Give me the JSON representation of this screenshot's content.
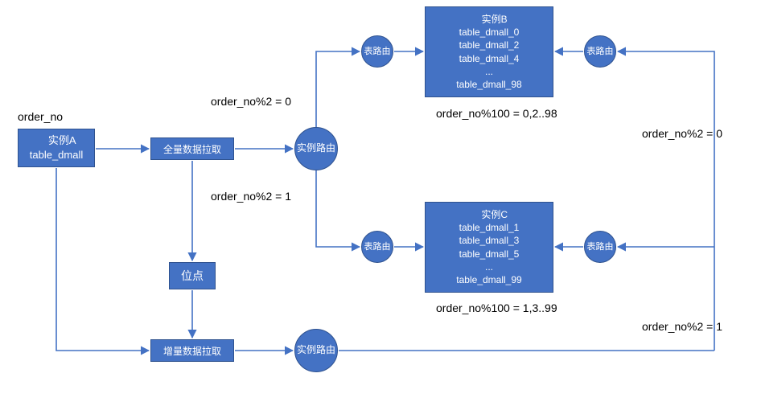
{
  "labels": {
    "shard_key": "order_no",
    "cond_even": "order_no%2 = 0",
    "cond_odd": "order_no%2 = 1",
    "mod_even": "order_no%100 = 0,2..98",
    "mod_odd": "order_no%100 = 1,3..99"
  },
  "nodes": {
    "instanceA": {
      "title": "实例A",
      "table": "table_dmall"
    },
    "full_fetch": "全量数据拉取",
    "checkpoint": "位点",
    "inc_fetch": "增量数据拉取",
    "instance_router": "实例路由",
    "table_router": "表路由",
    "instanceB": {
      "title": "实例B",
      "tables": [
        "table_dmall_0",
        "table_dmall_2",
        "table_dmall_4",
        "...",
        "table_dmall_98"
      ]
    },
    "instanceC": {
      "title": "实例C",
      "tables": [
        "table_dmall_1",
        "table_dmall_3",
        "table_dmall_5",
        "...",
        "table_dmall_99"
      ]
    }
  },
  "colors": {
    "node_fill": "#4472c4",
    "node_stroke": "#2f528f",
    "arrow": "#4472c4"
  }
}
